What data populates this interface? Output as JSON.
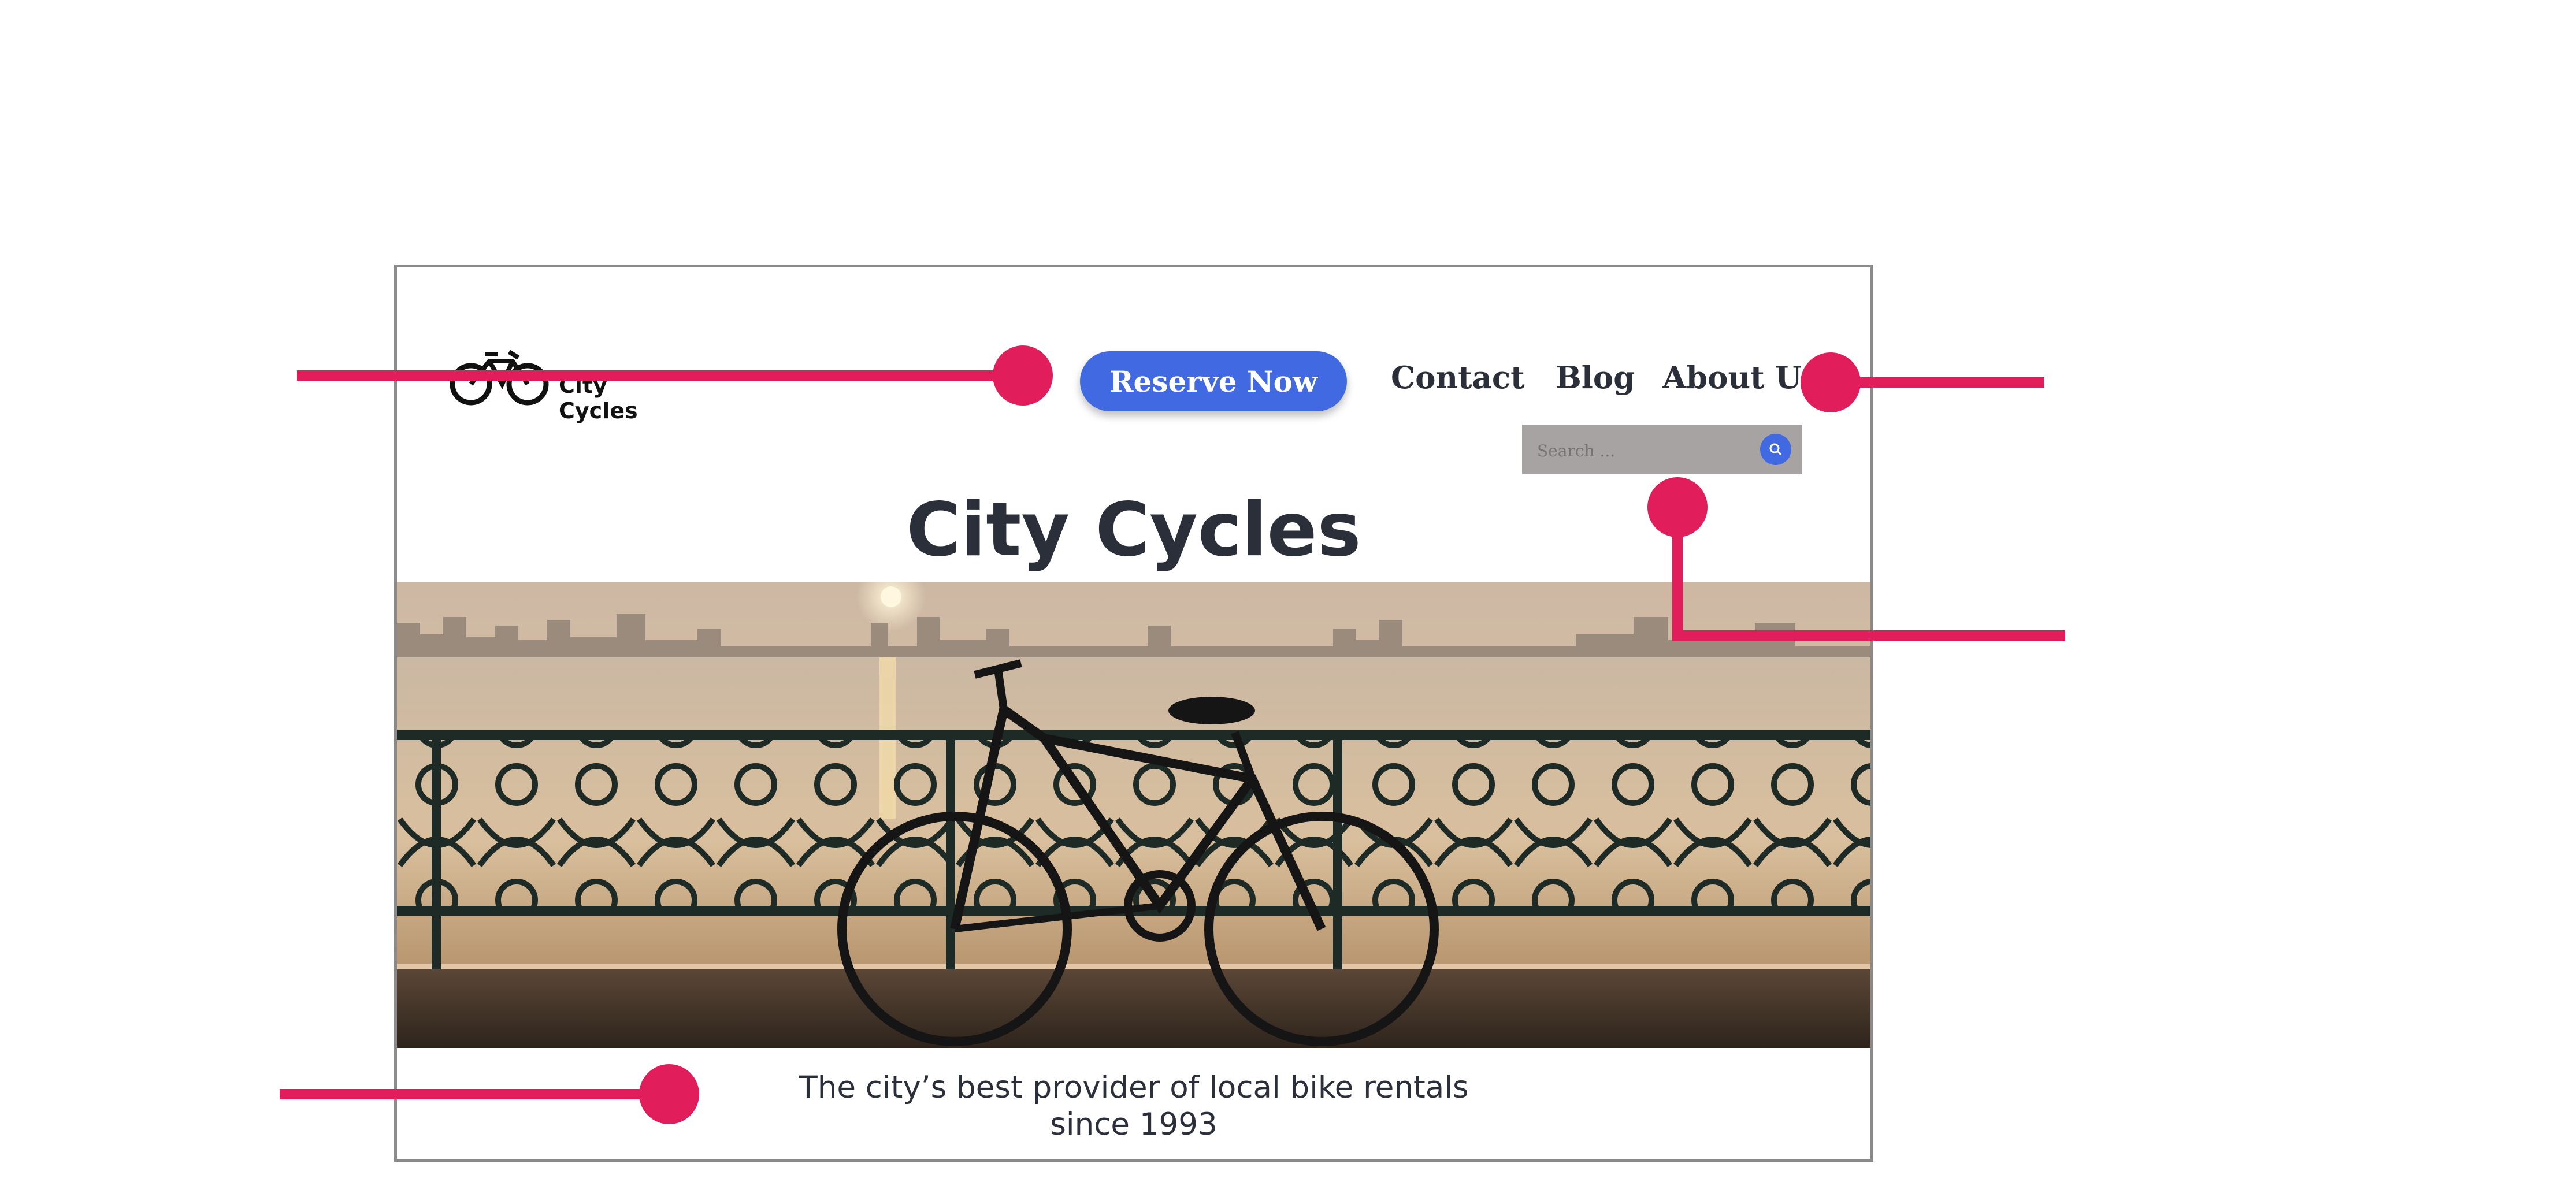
{
  "site": {
    "logo_text": "City Cycles",
    "reserve_label": "Reserve Now",
    "nav": [
      {
        "label": "Contact"
      },
      {
        "label": "Blog"
      },
      {
        "label": "About Us"
      }
    ],
    "search": {
      "placeholder": "Search ..."
    },
    "title": "City Cycles",
    "tagline_line1": "The city’s best provider of local bike rentals",
    "tagline_line2": "since 1993"
  },
  "colors": {
    "accent": "#4169e1",
    "text": "#2b2f3a",
    "callout": "#e21d5b",
    "search_bg": "#a7a3a3"
  },
  "icons": {
    "logo": "bicycle-icon",
    "search": "search-icon"
  },
  "hero": {
    "subject": "bicycle-silhouette-at-sunset"
  }
}
